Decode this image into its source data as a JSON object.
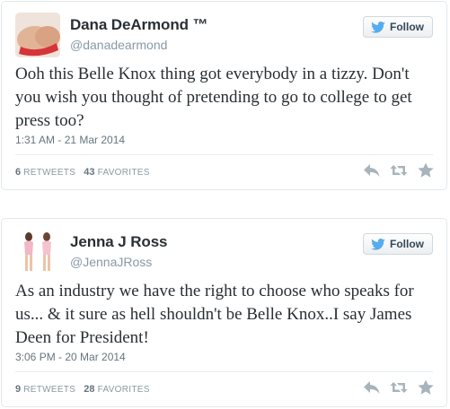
{
  "colors": {
    "border": "#e1e8ed",
    "name": "#292f33",
    "muted": "#8899a6",
    "twitter_blue": "#55acee",
    "action_gray": "#a8b4bc"
  },
  "tweets": [
    {
      "name": "Dana DeArmond ™",
      "handle": "@danadearmond",
      "follow_label": "Follow",
      "text": "Ooh this Belle Knox thing got everybody in a tizzy. Don't you wish you thought of pretending to go to college to get press too?",
      "timestamp": "1:31 AM - 21 Mar 2014",
      "retweets_count": "6",
      "retweets_label": "RETWEETS",
      "favorites_count": "43",
      "favorites_label": "FAVORITES",
      "icons": [
        "twitter-bird-icon",
        "reply-icon",
        "retweet-icon",
        "favorite-star-icon"
      ]
    },
    {
      "name": "Jenna J Ross",
      "handle": "@JennaJRoss",
      "follow_label": "Follow",
      "text": "As an industry we have the right to choose who speaks for us... & it sure as hell shouldn't be Belle Knox..I say James Deen for President!",
      "timestamp": "3:06 PM - 20 Mar 2014",
      "retweets_count": "9",
      "retweets_label": "RETWEETS",
      "favorites_count": "28",
      "favorites_label": "FAVORITES",
      "icons": [
        "twitter-bird-icon",
        "reply-icon",
        "retweet-icon",
        "favorite-star-icon"
      ]
    }
  ]
}
